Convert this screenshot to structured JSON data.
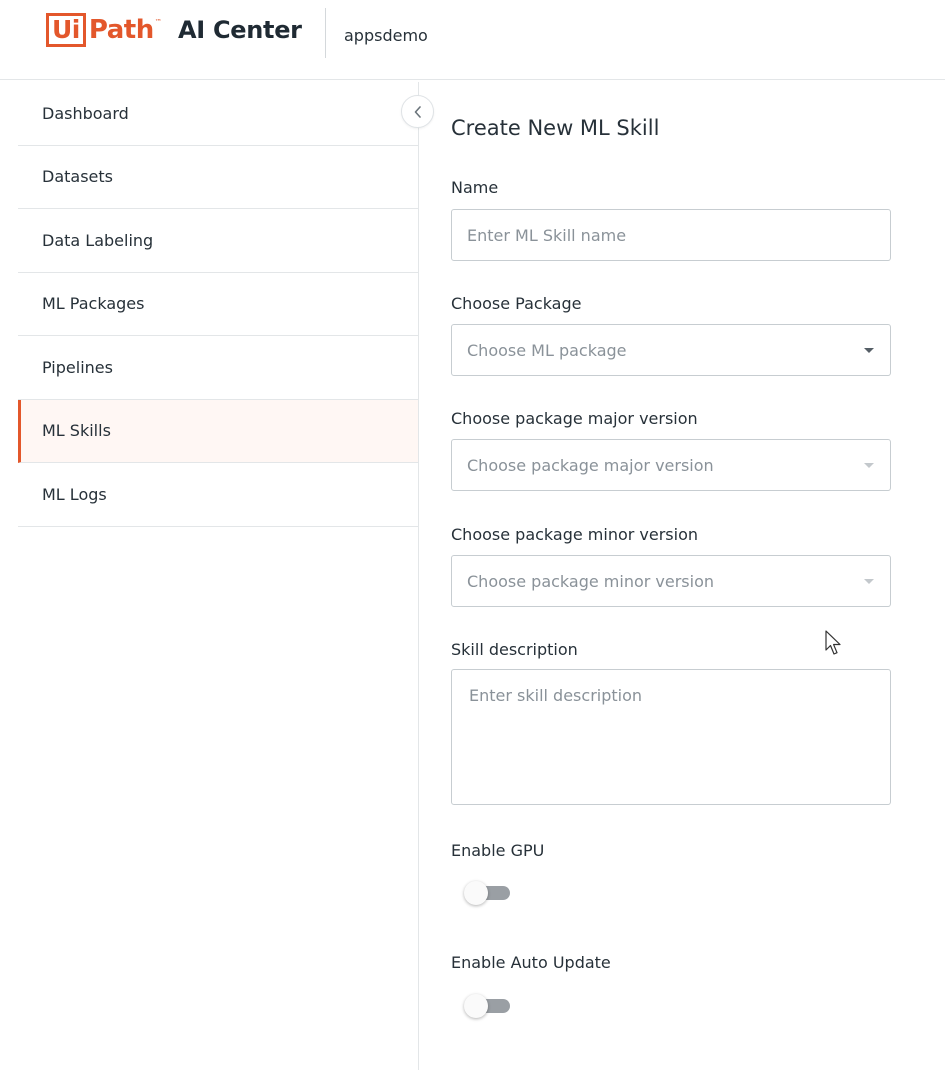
{
  "header": {
    "logo_ui": "Ui",
    "logo_path": "Path",
    "logo_tm": "™",
    "product_name": "AI Center",
    "tenant": "appsdemo"
  },
  "sidebar": {
    "items": [
      {
        "label": "Dashboard"
      },
      {
        "label": "Datasets"
      },
      {
        "label": "Data Labeling"
      },
      {
        "label": "ML Packages"
      },
      {
        "label": "Pipelines"
      },
      {
        "label": "ML Skills",
        "active": true
      },
      {
        "label": "ML Logs"
      }
    ],
    "collapse_icon": "chevron-left-icon"
  },
  "form": {
    "title": "Create New ML Skill",
    "name_label": "Name",
    "name_placeholder": "Enter ML Skill name",
    "package_label": "Choose Package",
    "package_placeholder": "Choose ML package",
    "major_label": "Choose package major version",
    "major_placeholder": "Choose package major version",
    "minor_label": "Choose package minor version",
    "minor_placeholder": "Choose package minor version",
    "description_label": "Skill description",
    "description_placeholder": "Enter skill description",
    "gpu_label": "Enable GPU",
    "gpu_enabled": false,
    "auto_update_label": "Enable Auto Update",
    "auto_update_enabled": false
  },
  "colors": {
    "brand": "#e3572b",
    "text": "#273139",
    "placeholder": "#8a9299",
    "border": "#c7cdd1",
    "toggle_off": "#9a9fa4"
  }
}
